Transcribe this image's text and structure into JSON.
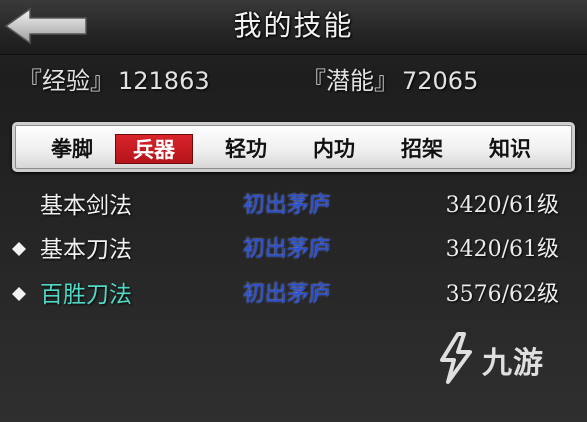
{
  "header": {
    "title": "我的技能",
    "back_icon": "back-arrow-icon"
  },
  "stats": {
    "experience": {
      "label": "『经验』",
      "value": "121863"
    },
    "potential": {
      "label": "『潜能』",
      "value": "72065"
    }
  },
  "tabs": [
    {
      "label": "拳脚",
      "active": false
    },
    {
      "label": "兵器",
      "active": true
    },
    {
      "label": "轻功",
      "active": false
    },
    {
      "label": "内功",
      "active": false
    },
    {
      "label": "招架",
      "active": false
    },
    {
      "label": "知识",
      "active": false
    }
  ],
  "skills": [
    {
      "name": "基本剑法",
      "rank": "初出茅庐",
      "level": "3420/61级",
      "bullet": false,
      "highlight": false
    },
    {
      "name": "基本刀法",
      "rank": "初出茅庐",
      "level": "3420/61级",
      "bullet": true,
      "highlight": false
    },
    {
      "name": "百胜刀法",
      "rank": "初出茅庐",
      "level": "3576/62级",
      "bullet": true,
      "highlight": true
    }
  ],
  "colors": {
    "active_tab": "#c41c22",
    "rank_text": "#2a4fd0",
    "highlight_skill": "#4fd8c4"
  },
  "watermark": {
    "text": "九游",
    "icon": "jiuyou-logo-icon"
  }
}
